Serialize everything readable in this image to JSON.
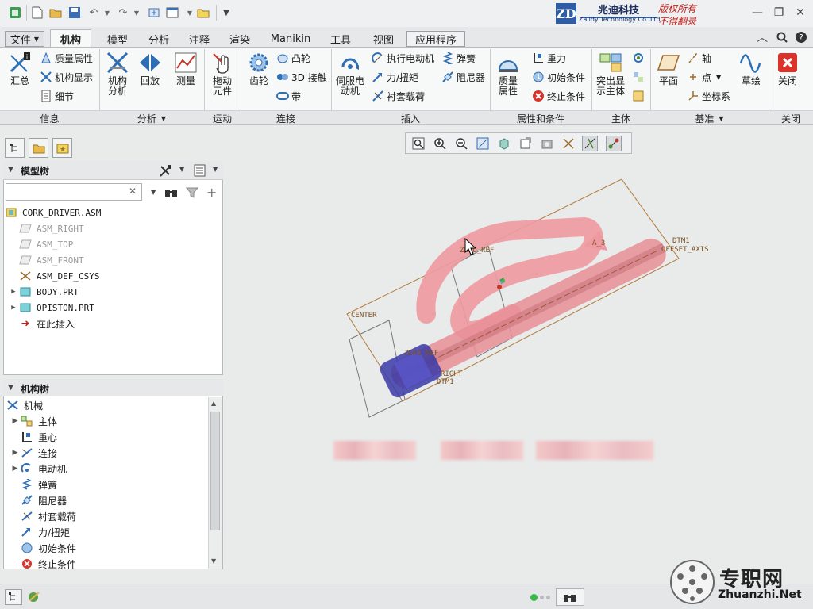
{
  "brand": {
    "company": "兆迪科技",
    "company_en": "Zalldy Technology Co.,Ltd.",
    "slogan1": "版权所有",
    "slogan2": "不得翻录"
  },
  "tabs": [
    {
      "label": "文件"
    },
    {
      "label": "机构"
    },
    {
      "label": "模型"
    },
    {
      "label": "分析"
    },
    {
      "label": "注释"
    },
    {
      "label": "渲染"
    },
    {
      "label": "Manikin"
    },
    {
      "label": "工具"
    },
    {
      "label": "视图"
    },
    {
      "label": "应用程序"
    }
  ],
  "ribbon": {
    "info": {
      "summary": "汇总",
      "mass_props": "质量属性",
      "mech_display": "机构显示",
      "details": "细节"
    },
    "analysis": {
      "mech_analysis": "机构\n分析",
      "playback": "回放",
      "measure": "测量"
    },
    "motion": {
      "drag": "拖动\n元件"
    },
    "connect": {
      "gear": "齿轮",
      "cam": "凸轮",
      "contact3d": "3D 接触",
      "belt": "带"
    },
    "insert": {
      "servo": "伺服电\n动机",
      "exec_motor": "执行电动机",
      "force": "力/扭矩",
      "bushing": "衬套载荷",
      "spring": "弹簧",
      "damper": "阻尼器"
    },
    "props": {
      "mass_props": "质量\n属性",
      "gravity": "重力",
      "init_cond": "初始条件",
      "term_cond": "终止条件"
    },
    "body": {
      "highlight": "突出显\n示主体"
    },
    "datum": {
      "plane": "平面",
      "axis": "轴",
      "point": "点",
      "csys": "坐标系",
      "sketch": "草绘"
    },
    "close": {
      "close": "关闭"
    }
  },
  "groups": [
    "信息",
    "分析",
    "运动",
    "连接",
    "插入",
    "属性和条件",
    "主体",
    "基准",
    "关闭"
  ],
  "model_tree": {
    "title": "模型树",
    "items": [
      {
        "label": "CORK_DRIVER.ASM",
        "dim": false
      },
      {
        "label": "ASM_RIGHT",
        "dim": true
      },
      {
        "label": "ASM_TOP",
        "dim": true
      },
      {
        "label": "ASM_FRONT",
        "dim": true
      },
      {
        "label": "ASM_DEF_CSYS",
        "dim": false
      },
      {
        "label": "BODY.PRT",
        "dim": false
      },
      {
        "label": "OPISTON.PRT",
        "dim": false
      },
      {
        "label": "在此插入",
        "dim": false
      }
    ]
  },
  "mech_tree": {
    "title": "机构树",
    "items": [
      {
        "label": "机械"
      },
      {
        "label": "主体"
      },
      {
        "label": "重心"
      },
      {
        "label": "连接"
      },
      {
        "label": "电动机"
      },
      {
        "label": "弹簧"
      },
      {
        "label": "阻尼器"
      },
      {
        "label": "衬套载荷"
      },
      {
        "label": "力/扭矩"
      },
      {
        "label": "初始条件"
      },
      {
        "label": "终止条件"
      }
    ]
  },
  "viewport_labels": {
    "zero_ref": "ZERO_REF",
    "dtm1": "DTM1",
    "offset_axis": "OFFSET_AXIS",
    "center": "CENTER",
    "zero_ref2": "ZERO_REF",
    "right": "RIGHT",
    "dtm1b": "DTM1",
    "a3": "A_3"
  },
  "watermark": {
    "site_cn": "专职网",
    "site": "Zhuanzhi.Net"
  },
  "colors": {
    "accent": "#2e6eb5",
    "part": "#e89a9f",
    "datum": "#a06a2a",
    "close": "#d9332b"
  }
}
